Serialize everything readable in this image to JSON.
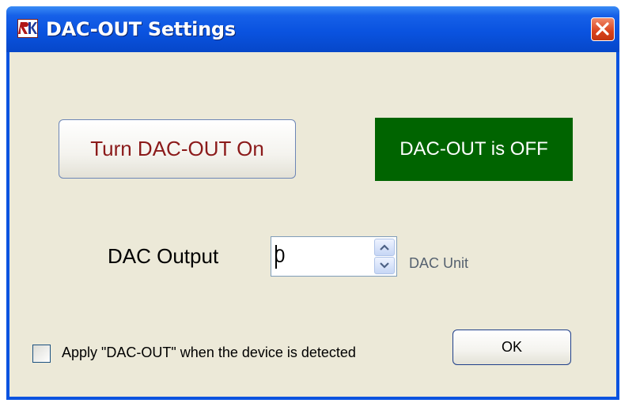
{
  "window": {
    "title": "DAC-OUT Settings",
    "app_icon": "rk-logo-icon",
    "close_icon": "close-icon",
    "colors": {
      "titlebar": "#0a53e0",
      "client": "#ece9d8",
      "close": "#d9421c"
    }
  },
  "controls": {
    "toggle_button_label": "Turn DAC-OUT On",
    "status_text": "DAC-OUT is OFF",
    "status_color": "#006400",
    "status_text_color": "#ffffff",
    "dac_output_label": "DAC Output",
    "dac_output_value": "0",
    "spin_up_icon": "chevron-up-icon",
    "spin_down_icon": "chevron-down-icon",
    "unit_label": "DAC Unit",
    "apply_checkbox_label": "Apply \"DAC-OUT\" when the device is detected",
    "apply_checkbox_checked": false,
    "ok_button_label": "OK",
    "toggle_text_color": "#8b1a1a"
  }
}
